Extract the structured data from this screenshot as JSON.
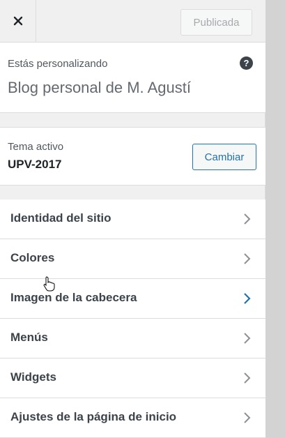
{
  "header": {
    "close_icon": "close-icon",
    "publish_label": "Publicada"
  },
  "info": {
    "label": "Estás personalizando",
    "site_name": "Blog personal de M. Agustí",
    "help_glyph": "?"
  },
  "theme": {
    "label": "Tema activo",
    "name": "UPV-2017",
    "change_label": "Cambiar"
  },
  "menu": {
    "items": [
      {
        "label": "Identidad del sitio",
        "active": false
      },
      {
        "label": "Colores",
        "active": false
      },
      {
        "label": "Imagen de la cabecera",
        "active": true
      },
      {
        "label": "Menús",
        "active": false
      },
      {
        "label": "Widgets",
        "active": false
      },
      {
        "label": "Ajustes de la página de inicio",
        "active": false
      }
    ]
  },
  "colors": {
    "accent": "#2271b1",
    "chevron": "#8c8f94"
  }
}
